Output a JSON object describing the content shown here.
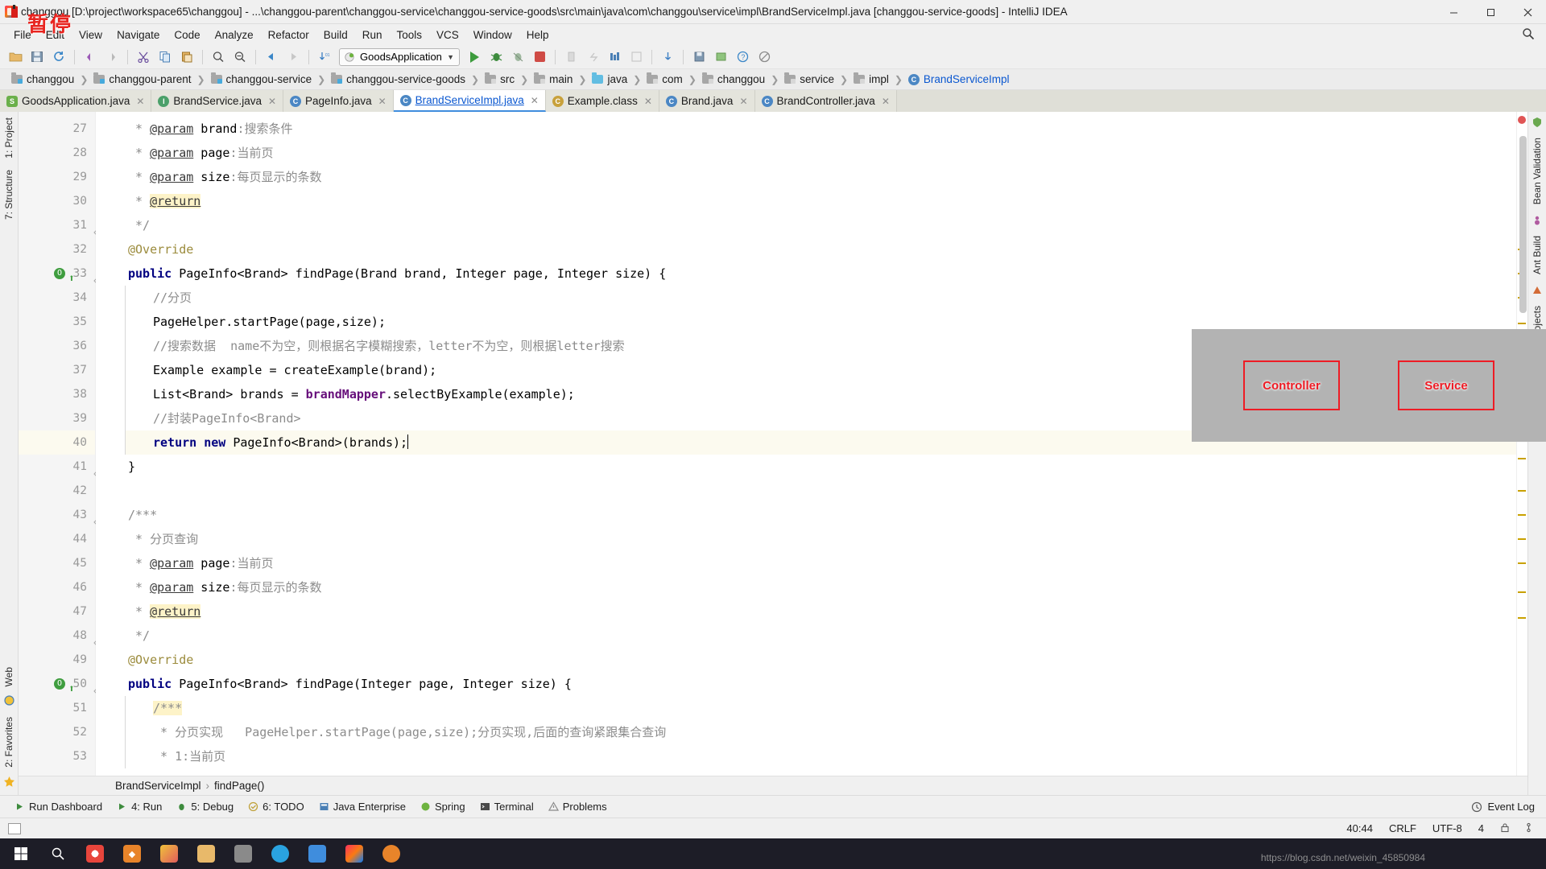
{
  "window": {
    "title": "changgou [D:\\project\\workspace65\\changgou] - ...\\changgou-parent\\changgou-service\\changgou-service-goods\\src\\main\\java\\com\\changgou\\service\\impl\\BrandServiceImpl.java [changgou-service-goods] - IntelliJ IDEA",
    "watermark": "暂停",
    "minimize": "–",
    "maximize": "▢",
    "close": "✕"
  },
  "menu": {
    "items": [
      "File",
      "Edit",
      "View",
      "Navigate",
      "Code",
      "Analyze",
      "Refactor",
      "Build",
      "Run",
      "Tools",
      "VCS",
      "Window",
      "Help"
    ],
    "search_icon": "search-icon"
  },
  "toolbar": {
    "run_config": "GoodsApplication",
    "icons": [
      "open-folder-icon",
      "save-all-icon",
      "sync-icon",
      "undo-icon",
      "redo-icon",
      "cut-icon",
      "copy-icon",
      "paste-icon",
      "back-icon",
      "forward-icon",
      "find-icon",
      "replace-icon",
      "compile-icon"
    ],
    "right_icons": [
      "run-icon",
      "debug-icon",
      "run-coverage-icon",
      "stop-icon",
      "profile-icon",
      "build-icon",
      "structure-icon",
      "settings-icon",
      "help-icon",
      "search-everywhere-icon"
    ]
  },
  "breadcrumbs": [
    {
      "label": "changgou",
      "icon": "module-folder-icon"
    },
    {
      "label": "changgou-parent",
      "icon": "module-folder-icon"
    },
    {
      "label": "changgou-service",
      "icon": "module-folder-icon"
    },
    {
      "label": "changgou-service-goods",
      "icon": "module-folder-icon"
    },
    {
      "label": "src",
      "icon": "folder-icon"
    },
    {
      "label": "main",
      "icon": "folder-icon"
    },
    {
      "label": "java",
      "icon": "source-folder-icon"
    },
    {
      "label": "com",
      "icon": "package-icon"
    },
    {
      "label": "changgou",
      "icon": "package-icon"
    },
    {
      "label": "service",
      "icon": "package-icon"
    },
    {
      "label": "impl",
      "icon": "package-icon"
    },
    {
      "label": "BrandServiceImpl",
      "icon": "java-class-icon"
    }
  ],
  "tabs": [
    {
      "label": "GoodsApplication.java",
      "icon": "spring-class-icon",
      "active": false
    },
    {
      "label": "BrandService.java",
      "icon": "java-interface-icon",
      "active": false
    },
    {
      "label": "PageInfo.java",
      "icon": "java-class-icon",
      "active": false
    },
    {
      "label": "BrandServiceImpl.java",
      "icon": "java-class-icon",
      "active": true
    },
    {
      "label": "Example.class",
      "icon": "compiled-class-icon",
      "active": false
    },
    {
      "label": "Brand.java",
      "icon": "java-class-icon",
      "active": false
    },
    {
      "label": "BrandController.java",
      "icon": "java-class-icon",
      "active": false
    }
  ],
  "left_strip": [
    "1: Project",
    "7: Structure",
    "Web",
    "2: Favorites"
  ],
  "right_strip": [
    "Bean Validation",
    "Ant Build",
    "Maven Projects"
  ],
  "editor": {
    "lines": [
      {
        "n": 27,
        "indent": 0,
        "segs": [
          {
            "t": " * ",
            "c": "cmt"
          },
          {
            "t": "@param",
            "c": "doc-tag"
          },
          {
            "t": " brand",
            "c": "doc-b"
          },
          {
            "t": ":搜索条件",
            "c": "cmt"
          }
        ]
      },
      {
        "n": 28,
        "indent": 0,
        "segs": [
          {
            "t": " * ",
            "c": "cmt"
          },
          {
            "t": "@param",
            "c": "doc-tag"
          },
          {
            "t": " page",
            "c": "doc-b"
          },
          {
            "t": ":当前页",
            "c": "cmt"
          }
        ]
      },
      {
        "n": 29,
        "indent": 0,
        "segs": [
          {
            "t": " * ",
            "c": "cmt"
          },
          {
            "t": "@param",
            "c": "doc-tag"
          },
          {
            "t": " size",
            "c": "doc-b"
          },
          {
            "t": ":每页显示的条数",
            "c": "cmt"
          }
        ]
      },
      {
        "n": 30,
        "indent": 0,
        "segs": [
          {
            "t": " * ",
            "c": "cmt"
          },
          {
            "t": "@return",
            "c": "doc-tag hl"
          }
        ]
      },
      {
        "n": 31,
        "indent": 0,
        "fold": true,
        "segs": [
          {
            "t": " */",
            "c": "cmt"
          }
        ]
      },
      {
        "n": 32,
        "indent": 0,
        "segs": [
          {
            "t": "@Override",
            "c": "anno"
          }
        ]
      },
      {
        "n": 33,
        "indent": 0,
        "gutterMark": "override",
        "fold": true,
        "segs": [
          {
            "t": "public",
            "c": "kw"
          },
          {
            "t": " PageInfo<Brand> findPage(Brand brand, Integer page, Integer size) {",
            "c": ""
          }
        ]
      },
      {
        "n": 34,
        "indent": 1,
        "segs": [
          {
            "t": "//分页",
            "c": "cmt"
          }
        ]
      },
      {
        "n": 35,
        "indent": 1,
        "segs": [
          {
            "t": "PageHelper.startPage(page,size);",
            "c": ""
          }
        ]
      },
      {
        "n": 36,
        "indent": 1,
        "segs": [
          {
            "t": "//搜索数据  name不为空，则根据名字模糊搜索，letter不为空，则根据letter搜索",
            "c": "cmt"
          }
        ]
      },
      {
        "n": 37,
        "indent": 1,
        "segs": [
          {
            "t": "Example example = createExample(brand);",
            "c": ""
          }
        ]
      },
      {
        "n": 38,
        "indent": 1,
        "segs": [
          {
            "t": "List<Brand> brands = ",
            "c": ""
          },
          {
            "t": "brandMapper",
            "c": "field"
          },
          {
            "t": ".selectByExample(example);",
            "c": ""
          }
        ]
      },
      {
        "n": 39,
        "indent": 1,
        "segs": [
          {
            "t": "//封装PageInfo<Brand>",
            "c": "cmt"
          }
        ]
      },
      {
        "n": 40,
        "indent": 1,
        "current": true,
        "segs": [
          {
            "t": "return",
            "c": "kw"
          },
          {
            "t": " ",
            "c": ""
          },
          {
            "t": "new",
            "c": "kw"
          },
          {
            "t": " PageInfo<Brand>(brands);",
            "c": ""
          }
        ],
        "caret": true
      },
      {
        "n": 41,
        "indent": 0,
        "fold": true,
        "segs": [
          {
            "t": "}",
            "c": ""
          }
        ]
      },
      {
        "n": 42,
        "indent": 0,
        "segs": []
      },
      {
        "n": 43,
        "indent": 0,
        "fold": true,
        "segs": [
          {
            "t": "/***",
            "c": "cmt"
          }
        ]
      },
      {
        "n": 44,
        "indent": 0,
        "segs": [
          {
            "t": " * 分页查询",
            "c": "cmt"
          }
        ]
      },
      {
        "n": 45,
        "indent": 0,
        "segs": [
          {
            "t": " * ",
            "c": "cmt"
          },
          {
            "t": "@param",
            "c": "doc-tag"
          },
          {
            "t": " page",
            "c": "doc-b"
          },
          {
            "t": ":当前页",
            "c": "cmt"
          }
        ]
      },
      {
        "n": 46,
        "indent": 0,
        "segs": [
          {
            "t": " * ",
            "c": "cmt"
          },
          {
            "t": "@param",
            "c": "doc-tag"
          },
          {
            "t": " size",
            "c": "doc-b"
          },
          {
            "t": ":每页显示的条数",
            "c": "cmt"
          }
        ]
      },
      {
        "n": 47,
        "indent": 0,
        "segs": [
          {
            "t": " * ",
            "c": "cmt"
          },
          {
            "t": "@return",
            "c": "doc-tag hl"
          }
        ]
      },
      {
        "n": 48,
        "indent": 0,
        "fold": true,
        "segs": [
          {
            "t": " */",
            "c": "cmt"
          }
        ]
      },
      {
        "n": 49,
        "indent": 0,
        "segs": [
          {
            "t": "@Override",
            "c": "anno"
          }
        ]
      },
      {
        "n": 50,
        "indent": 0,
        "gutterMark": "override",
        "fold": true,
        "segs": [
          {
            "t": "public",
            "c": "kw"
          },
          {
            "t": " PageInfo<Brand> findPage(Integer page, Integer size) {",
            "c": ""
          }
        ]
      },
      {
        "n": 51,
        "indent": 1,
        "segs": [
          {
            "t": "/***",
            "c": "cmt hl"
          }
        ]
      },
      {
        "n": 52,
        "indent": 1,
        "segs": [
          {
            "t": " * 分页实现   PageHelper.startPage(page,size);分页实现,后面的查询紧跟集合查询",
            "c": "cmt"
          }
        ]
      },
      {
        "n": 53,
        "indent": 1,
        "segs": [
          {
            "t": " * 1:当前页",
            "c": "cmt"
          }
        ]
      }
    ]
  },
  "overlay": {
    "boxes": [
      {
        "label": "Controller"
      },
      {
        "label": "Service"
      }
    ]
  },
  "bottom_breadcrumb": {
    "class_name": "BrandServiceImpl",
    "separator": "›",
    "method_name": "findPage()"
  },
  "tool_windows": [
    {
      "label": "Run Dashboard",
      "icon": "run-dashboard-icon"
    },
    {
      "label": "4: Run",
      "icon": "run-icon"
    },
    {
      "label": "5: Debug",
      "icon": "debug-icon"
    },
    {
      "label": "6: TODO",
      "icon": "todo-icon"
    },
    {
      "label": "Java Enterprise",
      "icon": "java-enterprise-icon"
    },
    {
      "label": "Spring",
      "icon": "spring-icon"
    },
    {
      "label": "Terminal",
      "icon": "terminal-icon"
    },
    {
      "label": "Problems",
      "icon": "problems-icon"
    }
  ],
  "event_log": {
    "label": "Event Log",
    "icon": "event-log-icon"
  },
  "status_bar": {
    "caret_position": "40:44",
    "line_separator": "CRLF",
    "encoding": "UTF-8",
    "indent": "4",
    "lock_icon": "lock-icon",
    "branch_icon": "git-branch-icon"
  },
  "taskbar": {
    "start_icon": "windows-start-icon",
    "search_icon": "search-icon",
    "items": [
      "chrome-icon",
      "app-orange-icon",
      "paint-icon",
      "explorer-icon",
      "files-icon",
      "browser-icon",
      "notes-icon",
      "intellij-icon",
      "media-icon"
    ],
    "watermark": "https://blog.csdn.net/weixin_45850984"
  }
}
